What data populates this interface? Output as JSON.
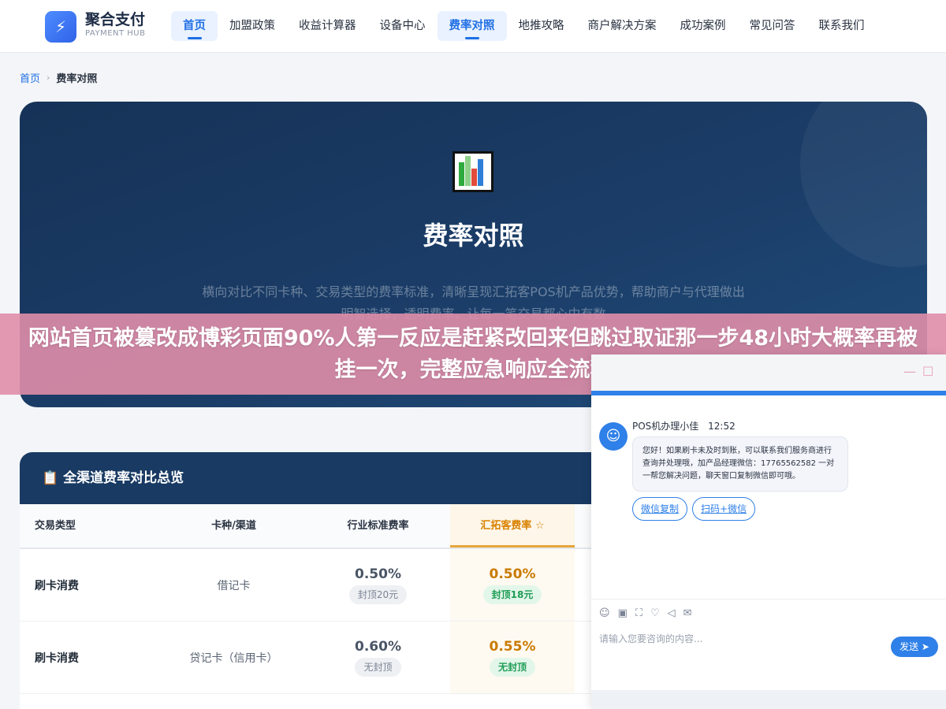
{
  "header": {
    "logo_glyph": "⚡",
    "brand_name": "聚合支付",
    "brand_sub": "PAYMENT HUB",
    "nav": [
      {
        "label": "首页",
        "active": true
      },
      {
        "label": "加盟政策",
        "active": false
      },
      {
        "label": "收益计算器",
        "active": false
      },
      {
        "label": "设备中心",
        "active": false
      },
      {
        "label": "费率对照",
        "active": true
      },
      {
        "label": "地推攻略",
        "active": false
      },
      {
        "label": "商户解决方案",
        "active": false
      },
      {
        "label": "成功案例",
        "active": false
      },
      {
        "label": "常见问答",
        "active": false
      },
      {
        "label": "联系我们",
        "active": false
      }
    ]
  },
  "breadcrumb": {
    "home": "首页",
    "separator": "›",
    "current": "费率对照"
  },
  "hero": {
    "title": "费率对照",
    "description": "横向对比不同卡种、交易类型的费率标准，清晰呈现汇拓客POS机产品优势，帮助商户与代理做出明智选择，透明费率、让每一笔交易都心中有数"
  },
  "banner": {
    "text": "网站首页被篡改成博彩页面90%人第一反应是赶紧改回来但跳过取证那一步48小时大概率再被挂一次，完整应急响应全流程"
  },
  "table": {
    "title_icon": "📋",
    "title": "全渠道费率对比总览",
    "headers": [
      "交易类型",
      "卡种/渠道",
      "行业标准费率",
      "汇拓客费率 ☆"
    ],
    "rows": [
      {
        "type": "刷卡消费",
        "card": "借记卡",
        "std_rate": "0.50%",
        "std_note": "封顶20元",
        "hk_rate": "0.50%",
        "hk_note": "封顶18元"
      },
      {
        "type": "刷卡消费",
        "card": "贷记卡（信用卡）",
        "std_rate": "0.60%",
        "std_note": "无封顶",
        "hk_rate": "0.55%",
        "hk_note": "无封顶"
      }
    ]
  },
  "chat": {
    "minimize": "—",
    "maximize": "☐",
    "avatar_glyph": "☺",
    "sender": "POS机办理小佳",
    "time": "12:52",
    "message": "您好！如果刷卡未及时到账，可以联系我们服务商进行查询并处理哦，加产品经理微信：17765562582 一对一帮您解决问题，聊天窗口复制微信即可哦。",
    "actions": [
      "微信复制",
      "扫码+微信"
    ],
    "tools": [
      "☺",
      "▣",
      "⛶",
      "♡",
      "◁",
      "✉"
    ],
    "input_placeholder": "请输入您要咨询的内容...",
    "send_label": "发送 ➤"
  },
  "colors": {
    "accent": "#1f6fe5",
    "hero_bg": "#1b3d68",
    "banner": "#e08ea8",
    "highlight": "#d98200",
    "success": "#1e9d55"
  }
}
